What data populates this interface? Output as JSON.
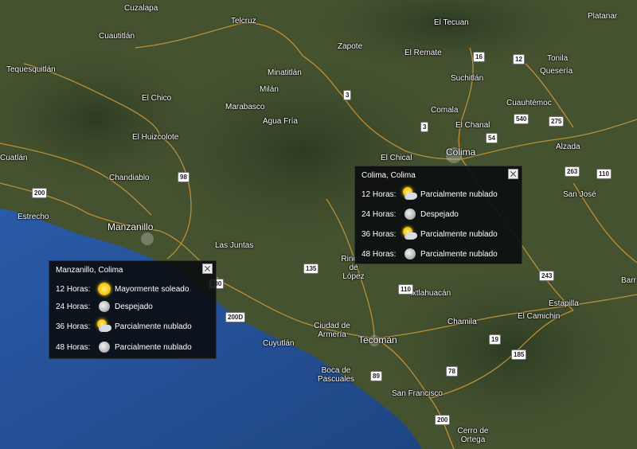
{
  "map": {
    "colors": {
      "land": "#3f4d2f",
      "water": "#2d5aa0",
      "road": "#d09a3a"
    },
    "places": [
      "Cuzalapa",
      "Telcruz",
      "El Tecuan",
      "Platanar",
      "Cuautitlán",
      "Zapote",
      "El Remate",
      "Tonila",
      "Tequesquitlán",
      "Minatitlán",
      "Suchitlán",
      "Quesería",
      "El Chico",
      "Milán",
      "Marabasco",
      "Agua Fría",
      "Comala",
      "Cuauhtémoc",
      "El Chanal",
      "El Huizcolote",
      "Colima",
      "Alzada",
      "Cuatlán",
      "Chandiablo",
      "El Chical",
      "Estrecho",
      "Manzanillo",
      "San José",
      "Las Juntas",
      "Rincón de López",
      "Ixtlahuacán",
      "Chamila",
      "El Camichin",
      "Estapilla",
      "Ciudad de Armería",
      "Cuyutlán",
      "Tecomán",
      "Boca de Pascuales",
      "San Francisco",
      "Cerro de Ortega",
      "Barr"
    ],
    "shields": [
      "16",
      "12",
      "540",
      "275",
      "3",
      "54",
      "3",
      "98",
      "263",
      "110",
      "200",
      "135",
      "110",
      "243",
      "200",
      "200D",
      "19",
      "185",
      "89",
      "78",
      "200"
    ]
  },
  "manzanillo_panel": {
    "title": "Manzanillo, Colima",
    "rows": [
      {
        "hours": "12 Horas:",
        "icon": "sun-icon",
        "desc": "Mayormente soleado"
      },
      {
        "hours": "24 Horas:",
        "icon": "moon-icon",
        "desc": "Despejado"
      },
      {
        "hours": "36 Horas:",
        "icon": "partly-cloudy-icon",
        "desc": "Parcialmente nublado"
      },
      {
        "hours": "48 Horas:",
        "icon": "cloudy-moon-icon",
        "desc": "Parcialmente nublado"
      }
    ]
  },
  "colima_panel": {
    "title": "Colima, Colima",
    "rows": [
      {
        "hours": "12 Horas:",
        "icon": "partly-cloudy-icon",
        "desc": "Parcialmente nublado"
      },
      {
        "hours": "24 Horas:",
        "icon": "moon-icon",
        "desc": "Despejado"
      },
      {
        "hours": "36 Horas:",
        "icon": "partly-cloudy-icon",
        "desc": "Parcialmente nublado"
      },
      {
        "hours": "48 Horas:",
        "icon": "cloudy-moon-icon",
        "desc": "Parcialmente nublado"
      }
    ]
  }
}
